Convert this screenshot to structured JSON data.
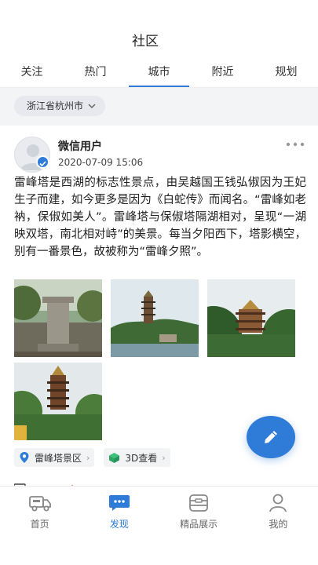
{
  "header": {
    "title": "社区"
  },
  "tabs": [
    {
      "label": "关注"
    },
    {
      "label": "热门"
    },
    {
      "label": "城市",
      "active": true
    },
    {
      "label": "附近"
    },
    {
      "label": "规划"
    }
  ],
  "filter": {
    "city": "浙江省杭州市",
    "icon": "chevron-down-icon"
  },
  "post": {
    "user": "微信用户",
    "time": "2020-07-09 15:06",
    "text": "雷峰塔是西湖的标志性景点，由吴越国王钱弘俶因为王妃生子而建，如今更多是因为《白蛇传》而闻名。“雷峰如老衲，保俶如美人”。雷峰塔与保俶塔隔湖相对，呈现“一湖映双塔，南北相对峙”的美景。每当夕阳西下，塔影横空，别有一番景色，故被称为“雷峰夕照”。",
    "photos": [
      "stone-monument",
      "pagoda-lake",
      "pagoda-hill",
      "pagoda-trees"
    ],
    "tags": [
      {
        "label": "雷峰塔景区",
        "icon": "location-pin-icon"
      },
      {
        "label": "3D查看",
        "icon": "cube-icon"
      }
    ]
  },
  "fab": {
    "icon": "pencil-icon"
  },
  "bottom_nav": [
    {
      "label": "首页",
      "icon": "truck-icon"
    },
    {
      "label": "发现",
      "icon": "chat-icon",
      "active": true
    },
    {
      "label": "精品展示",
      "icon": "box-icon"
    },
    {
      "label": "我的",
      "icon": "person-icon"
    }
  ],
  "colors": {
    "accent": "#2e7bd8",
    "filter_bg": "#f3f4f6"
  }
}
